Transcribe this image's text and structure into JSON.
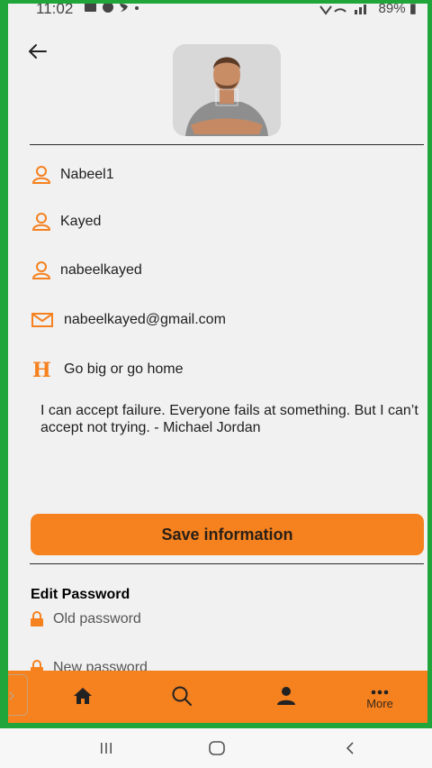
{
  "status_bar": {
    "time": "11:02",
    "notification_icons": [
      "gallery-icon",
      "app-icon",
      "twitter-icon",
      "dot-icon"
    ],
    "battery": "89%"
  },
  "profile": {
    "first_name": "Nabeel1",
    "last_name": "Kayed",
    "username": "nabeelkayed",
    "email": "nabeelkayed@gmail.com",
    "headline": "Go big or go home",
    "bio": "I can accept failure. Everyone fails at something. But I can’t accept not trying. - Michael Jordan"
  },
  "actions": {
    "save_label": "Save information"
  },
  "password": {
    "section_title": "Edit Password",
    "old_placeholder": "Old password",
    "new_placeholder": "New password"
  },
  "bottom_nav": {
    "items": [
      "home-icon",
      "search-icon",
      "profile-icon",
      "more-icon"
    ],
    "more_label": "More"
  },
  "colors": {
    "accent": "#f5811f",
    "frame": "#1fa53a",
    "background": "#f1f1f1"
  }
}
